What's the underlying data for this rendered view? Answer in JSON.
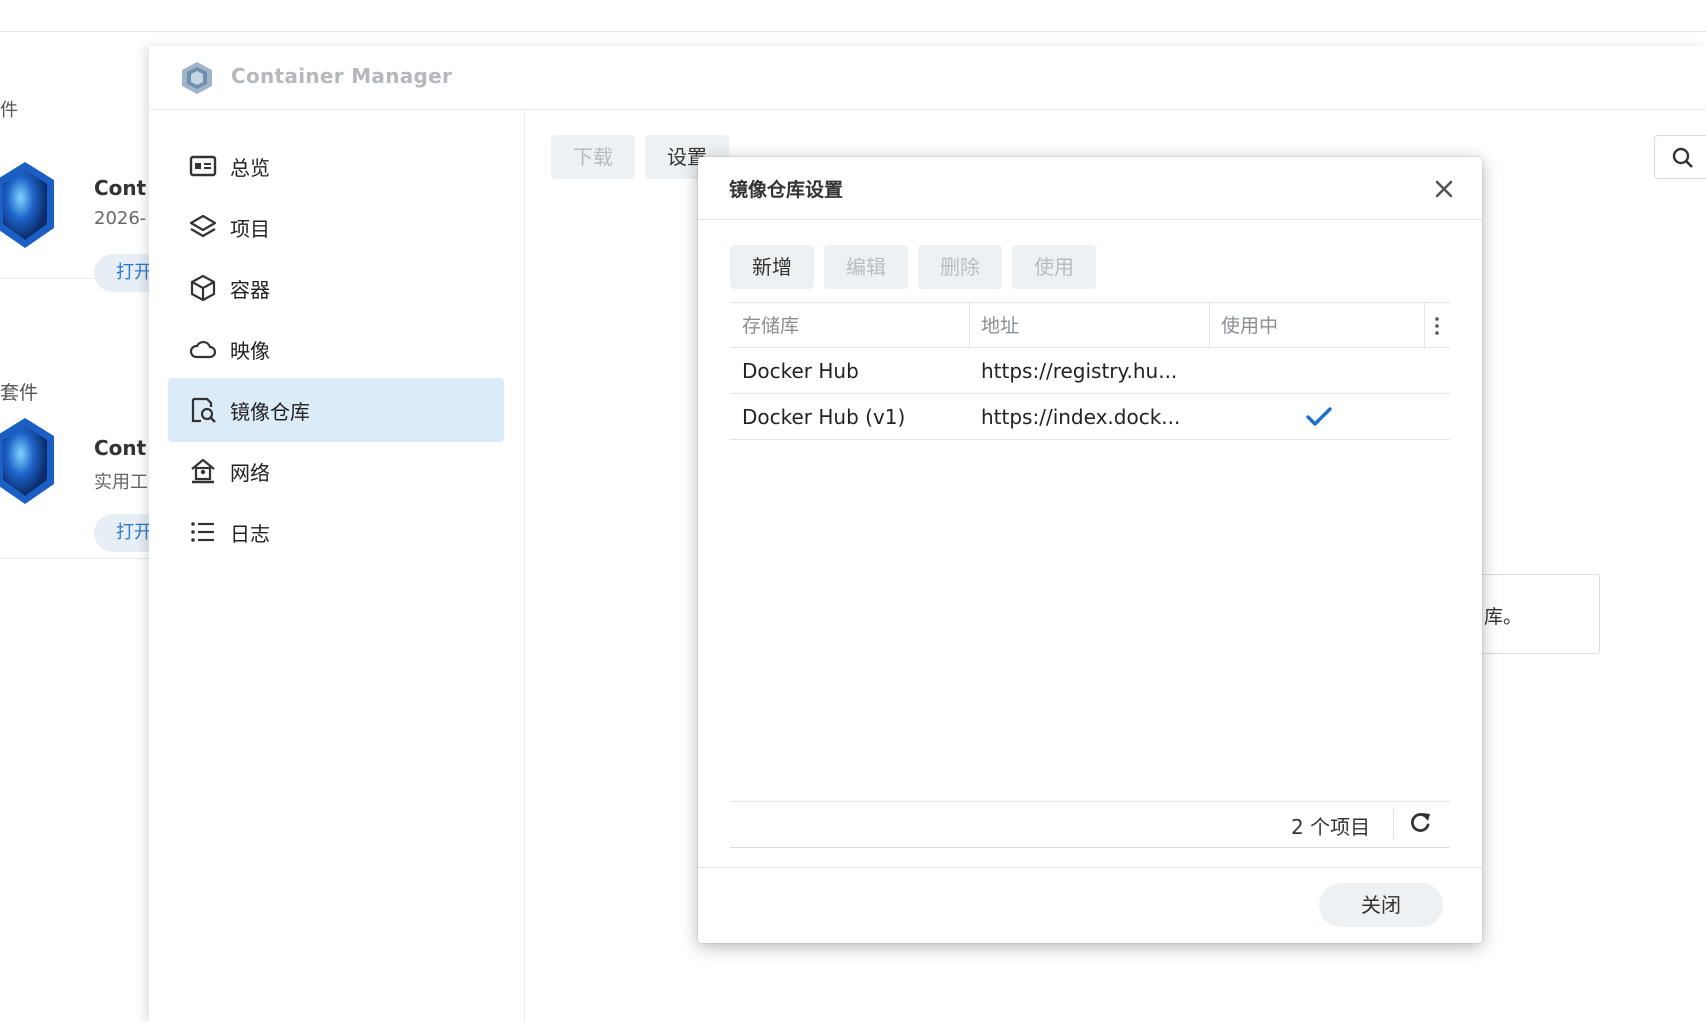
{
  "background_panel": {
    "header_fragment": "件",
    "section_fragment": "套件",
    "cards": [
      {
        "title": "Cont",
        "subtitle": "2026-",
        "open_label": "打开"
      },
      {
        "title": "Cont",
        "subtitle": "实用工",
        "open_label": "打开"
      }
    ]
  },
  "window": {
    "title": "Container Manager",
    "sidebar": [
      {
        "label": "总览",
        "icon": "overview-icon"
      },
      {
        "label": "项目",
        "icon": "project-layers-icon"
      },
      {
        "label": "容器",
        "icon": "container-cube-icon"
      },
      {
        "label": "映像",
        "icon": "image-cloud-icon"
      },
      {
        "label": "镜像仓库",
        "icon": "registry-search-icon",
        "active": true
      },
      {
        "label": "网络",
        "icon": "network-house-icon"
      },
      {
        "label": "日志",
        "icon": "log-list-icon"
      }
    ],
    "toolbar": {
      "download_label": "下载",
      "settings_label": "设置"
    },
    "tooltip_fragment": "库。"
  },
  "dialog": {
    "title": "镜像仓库设置",
    "buttons": {
      "add": "新增",
      "edit": "编辑",
      "delete": "删除",
      "use": "使用"
    },
    "columns": [
      "存储库",
      "地址",
      "使用中"
    ],
    "rows": [
      {
        "repository": "Docker Hub",
        "address": "https://registry.hu...",
        "in_use": false
      },
      {
        "repository": "Docker Hub (v1)",
        "address": "https://index.dock...",
        "in_use": true
      }
    ],
    "item_count": "2 个项目",
    "close_label": "关闭"
  },
  "colors": {
    "accent": "#1a6fd1",
    "active_nav": "#dcebf8",
    "button_bg": "#eef1f4"
  }
}
